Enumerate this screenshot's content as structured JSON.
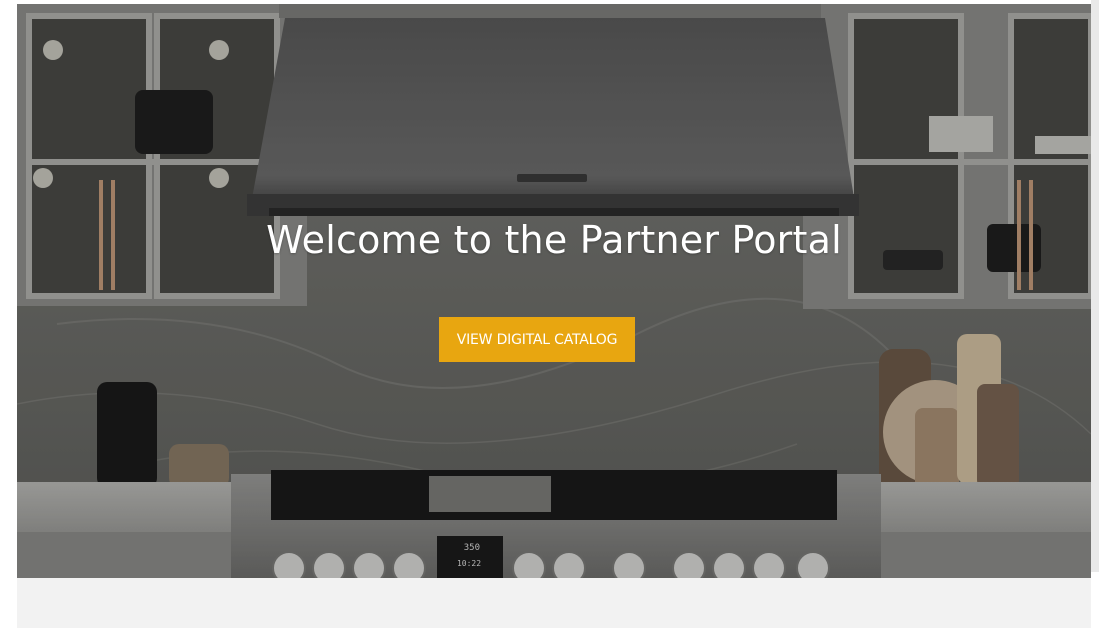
{
  "hero": {
    "title": "Welcome to the Partner Portal",
    "cta_label": "VIEW DIGITAL CATALOG",
    "range_display": {
      "temperature": "350",
      "time": "10:22"
    }
  },
  "colors": {
    "cta_background": "#e8a610",
    "title_text": "#ffffff",
    "footer_band": "#f2f2f2"
  }
}
